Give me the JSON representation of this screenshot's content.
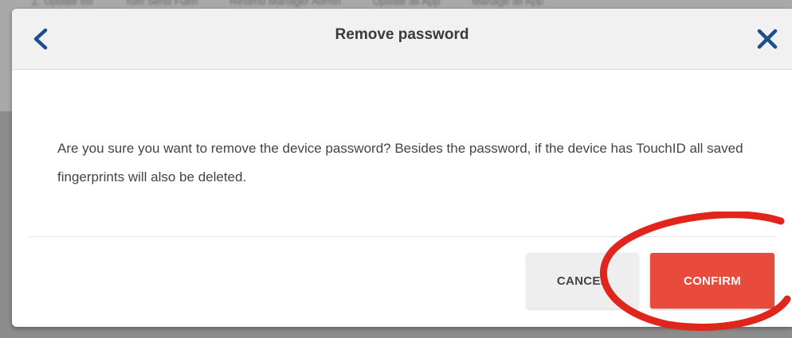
{
  "background": {
    "tabs": [
      "Z. Update list",
      "Tom Send Fuen",
      "Resend Manager Admin",
      "Update all App",
      "Manage all App"
    ]
  },
  "dialog": {
    "title": "Remove password",
    "back_icon": "chevron-left-icon",
    "close_icon": "close-icon",
    "message": "Are you sure you want to remove the device password? Besides the password, if the device has TouchID all saved fingerprints will also be deleted.",
    "cancel_label": "CANCEL",
    "confirm_label": "CONFIRM"
  },
  "colors": {
    "accent_blue": "#1e4f8c",
    "confirm_red": "#e84a3b",
    "annotation_red": "#e0261c"
  }
}
